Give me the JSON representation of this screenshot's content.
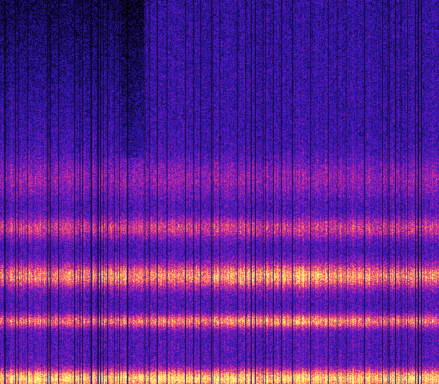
{
  "image": {
    "kind": "spectrogram",
    "colormap": [
      "#000000",
      "#160a50",
      "#2a19b8",
      "#5a18c8",
      "#b020a8",
      "#ff3a7a",
      "#ffb040",
      "#ffff90"
    ],
    "dark_stripe_color": "#05030c"
  }
}
